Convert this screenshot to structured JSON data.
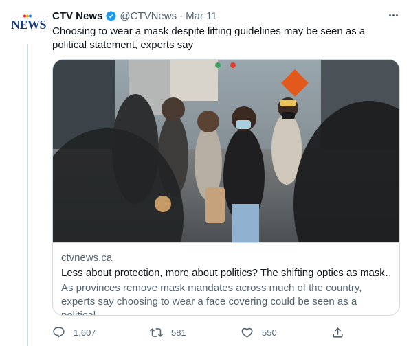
{
  "tweet": {
    "author_name": "CTV News",
    "handle": "@CTVNews",
    "separator": "·",
    "date": "Mar 11",
    "logo_text": "NEWS",
    "text": "Choosing to wear a mask despite lifting guidelines may be seen as a political statement, experts say",
    "verified_color": "#1d9bf0"
  },
  "card": {
    "domain": "ctvnews.ca",
    "title": "Less about protection, more about politics? The shifting optics as mask…",
    "description": "As provinces remove mask mandates across much of the country, experts say choosing to wear a face covering could be seen as a political …"
  },
  "actions": {
    "reply_count": "1,607",
    "retweet_count": "581",
    "like_count": "550",
    "icons": [
      "reply-icon",
      "retweet-icon",
      "like-icon",
      "share-icon"
    ]
  }
}
